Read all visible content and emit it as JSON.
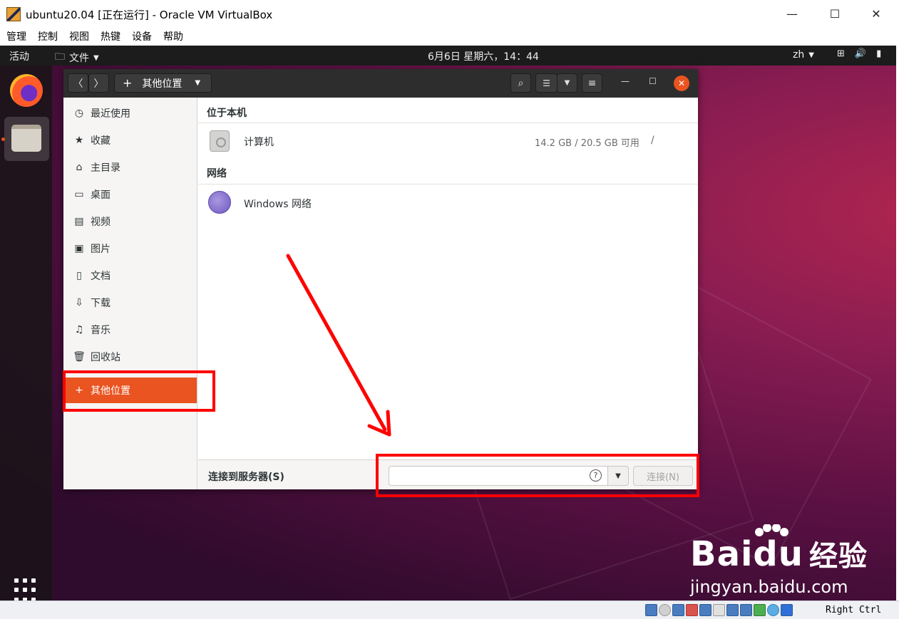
{
  "host_window": {
    "title": "ubuntu20.04 [正在运行] - Oracle VM VirtualBox",
    "minimize_glyph": "—",
    "maximize_glyph": "☐",
    "close_glyph": "✕",
    "menu": [
      "管理",
      "控制",
      "视图",
      "热键",
      "设备",
      "帮助"
    ]
  },
  "guest_topbar": {
    "activities": "活动",
    "app_menu": "文件",
    "clock": "6月6日 星期六，14：44",
    "input_method": "zh",
    "system_glyphs": [
      "⊞",
      "🔊",
      "▮"
    ]
  },
  "dock": {
    "items": [
      {
        "name": "firefox",
        "icon": "firefox-icon"
      },
      {
        "name": "files",
        "icon": "files-icon",
        "running": true
      }
    ],
    "show_apps_icon": "grid-icon"
  },
  "files_window": {
    "location": "其他位置",
    "sidebar": [
      {
        "label": "最近使用",
        "icon": "◷"
      },
      {
        "label": "收藏",
        "icon": "★"
      },
      {
        "label": "主目录",
        "icon": "⌂"
      },
      {
        "label": "桌面",
        "icon": "▭"
      },
      {
        "label": "视频",
        "icon": "▤"
      },
      {
        "label": "图片",
        "icon": "▣"
      },
      {
        "label": "文档",
        "icon": "▯"
      },
      {
        "label": "下载",
        "icon": "⇩"
      },
      {
        "label": "音乐",
        "icon": "♫"
      },
      {
        "label": "回收站",
        "icon": "🗑"
      }
    ],
    "other_locations": {
      "label": "其他位置",
      "icon": "+"
    },
    "sections": {
      "local": {
        "header": "位于本机",
        "items": [
          {
            "label": "计算机",
            "size": "14.2 GB / 20.5 GB 可用",
            "mount": "/"
          }
        ]
      },
      "network": {
        "header": "网络",
        "items": [
          {
            "label": "Windows 网络"
          }
        ]
      }
    },
    "connect_bar": {
      "label": "连接到服务器(S)",
      "input_value": "",
      "help_glyph": "?",
      "connect_label": "连接(N)"
    }
  },
  "annotations": {
    "color": "#ff0000"
  },
  "watermark": {
    "brand": "Baidu",
    "suffix": "经验",
    "url": "jingyan.baidu.com"
  },
  "status_bar": {
    "host_key": "Right Ctrl"
  },
  "colors": {
    "ubuntu_orange": "#e95420",
    "header_dark": "#2d2d2d"
  }
}
